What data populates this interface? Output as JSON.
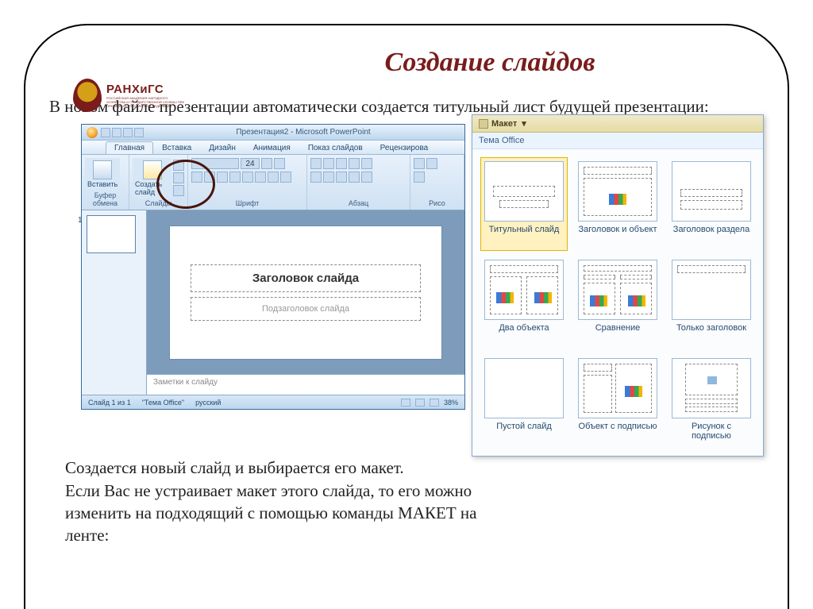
{
  "page": {
    "title": "Создание слайдов",
    "logo_top": "РАНХиГС",
    "logo_sub": "РОССИЙСКАЯ АКАДЕМИЯ НАРОДНОГО ХОЗЯЙСТВА И ГОСУДАРСТВЕННОЙ СЛУЖБЫ ПРИ ПРЕЗИДЕНТЕ РОССИЙСКОЙ ФЕДЕРАЦИИ",
    "intro": "В новом файле презентации автоматически создается титульный лист будущей презентации:",
    "outro": "Создается новый слайд и выбирается его макет.\nЕсли Вас не устраивает макет этого слайда, то его можно изменить на подходящий с помощью команды МАКЕТ на ленте:"
  },
  "pp": {
    "window_title": "Презентация2 - Microsoft PowerPoint",
    "tabs": [
      "Главная",
      "Вставка",
      "Дизайн",
      "Анимация",
      "Показ слайдов",
      "Рецензирова"
    ],
    "ribbon": {
      "paste": "Вставить",
      "clipboard": "Буфер обмена",
      "newslide": "Создать слайд",
      "slides": "Слайды",
      "font": "Шрифт",
      "fontsize": "24",
      "paragraph": "Абзац",
      "drawing": "Рисо"
    },
    "slide": {
      "title_ph": "Заголовок слайда",
      "subtitle_ph": "Подзаголовок слайда"
    },
    "notes_ph": "Заметки к слайду",
    "status": {
      "pos": "Слайд 1 из 1",
      "theme": "\"Тема Office\"",
      "lang": "русский",
      "zoom": "38%"
    }
  },
  "gallery": {
    "button": "Макет",
    "section": "Тема Office",
    "items": [
      "Титульный слайд",
      "Заголовок и объект",
      "Заголовок раздела",
      "Два объекта",
      "Сравнение",
      "Только заголовок",
      "Пустой слайд",
      "Объект с подписью",
      "Рисунок с подписью"
    ]
  }
}
